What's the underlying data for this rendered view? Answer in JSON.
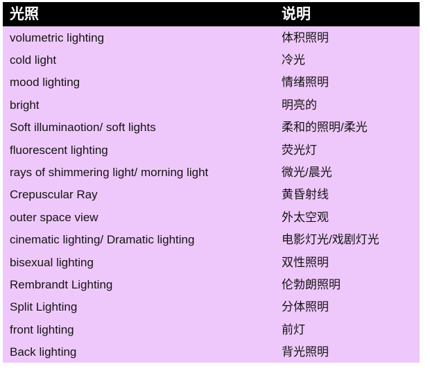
{
  "table": {
    "columns": [
      {
        "key": "term",
        "header": "光照"
      },
      {
        "key": "description",
        "header": "说明"
      }
    ],
    "rows": [
      {
        "term": "volumetric lighting",
        "description": "体积照明"
      },
      {
        "term": "cold light",
        "description": "冷光"
      },
      {
        "term": "mood lighting",
        "description": "情绪照明"
      },
      {
        "term": "bright",
        "description": "明亮的"
      },
      {
        "term": "Soft illuminaotion/ soft lights",
        "description": "柔和的照明/柔光"
      },
      {
        "term": "fluorescent lighting",
        "description": "荧光灯"
      },
      {
        "term": "rays of shimmering light/ morning light",
        "description": "微光/晨光"
      },
      {
        "term": "Crepuscular Ray",
        "description": "黄昏射线"
      },
      {
        "term": "outer space view",
        "description": "外太空观"
      },
      {
        "term": "cinematic lighting/ Dramatic lighting",
        "description": "电影灯光/戏剧灯光"
      },
      {
        "term": "bisexual lighting",
        "description": "双性照明"
      },
      {
        "term": "Rembrandt Lighting",
        "description": "伦勃朗照明"
      },
      {
        "term": "Split Lighting",
        "description": "分体照明"
      },
      {
        "term": "front lighting",
        "description": "前灯"
      },
      {
        "term": "Back lighting",
        "description": "背光照明"
      }
    ]
  },
  "colors": {
    "header_background": "#000000",
    "header_text": "#ffffff",
    "row_background": "#efc8fb",
    "row_text": "#131313",
    "page_background": "#ffffff"
  }
}
